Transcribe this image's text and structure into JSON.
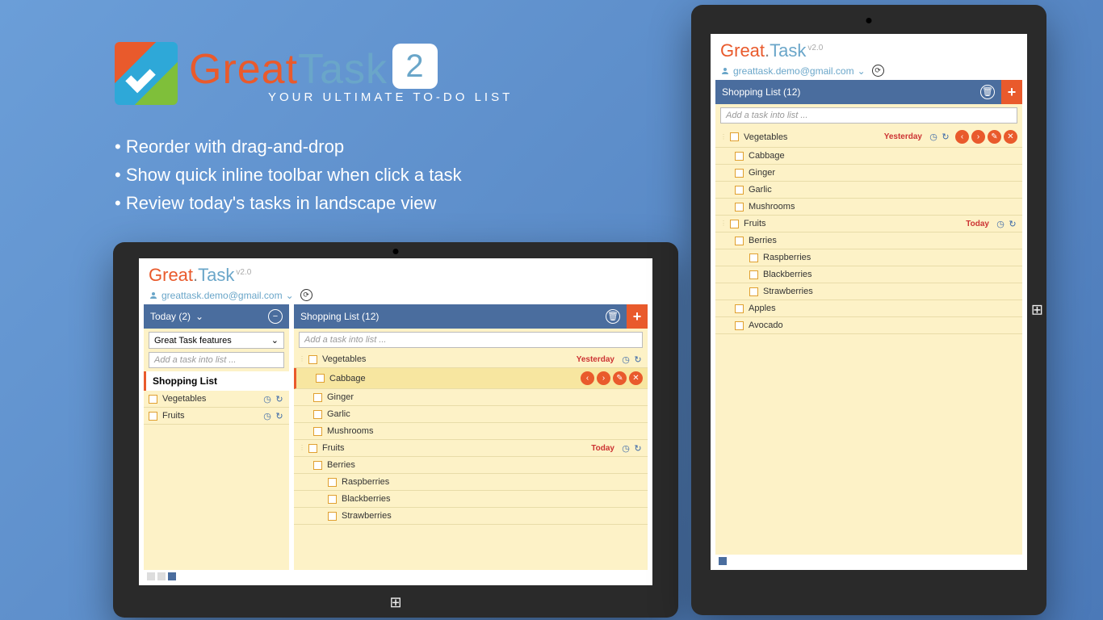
{
  "promo": {
    "brand_first": "Great",
    "brand_sep": ".",
    "brand_last": "Task",
    "badge": "2",
    "tagline": "YOUR ULTIMATE TO-DO LIST",
    "bullets": [
      "Reorder with drag-and-drop",
      "Show quick inline toolbar when click a task",
      "Review today's tasks in landscape view"
    ]
  },
  "app": {
    "title_first": "Great",
    "title_sep": ".",
    "title_last": "Task",
    "version": "v2.0",
    "account": "greattask.demo@gmail.com"
  },
  "landscape": {
    "today_header": "Today (2)",
    "feature_select": "Great Task features",
    "add_placeholder": "Add a task into list ...",
    "section": "Shopping List",
    "today_items": [
      {
        "label": "Vegetables"
      },
      {
        "label": "Fruits"
      }
    ],
    "main_header": "Shopping List (12)",
    "veg": {
      "label": "Vegetables",
      "due": "Yesterday"
    },
    "veg_items": [
      "Cabbage",
      "Ginger",
      "Garlic",
      "Mushrooms"
    ],
    "fruits": {
      "label": "Fruits",
      "due": "Today"
    },
    "berries": "Berries",
    "berry_items": [
      "Raspberries",
      "Blackberries",
      "Strawberries"
    ]
  },
  "portrait": {
    "main_header": "Shopping List (12)",
    "add_placeholder": "Add a task into list ...",
    "veg": {
      "label": "Vegetables",
      "due": "Yesterday"
    },
    "veg_items": [
      "Cabbage",
      "Ginger",
      "Garlic",
      "Mushrooms"
    ],
    "fruits": {
      "label": "Fruits",
      "due": "Today"
    },
    "berries": "Berries",
    "berry_items": [
      "Raspberries",
      "Blackberries",
      "Strawberries"
    ],
    "extra": [
      "Apples",
      "Avocado"
    ]
  }
}
